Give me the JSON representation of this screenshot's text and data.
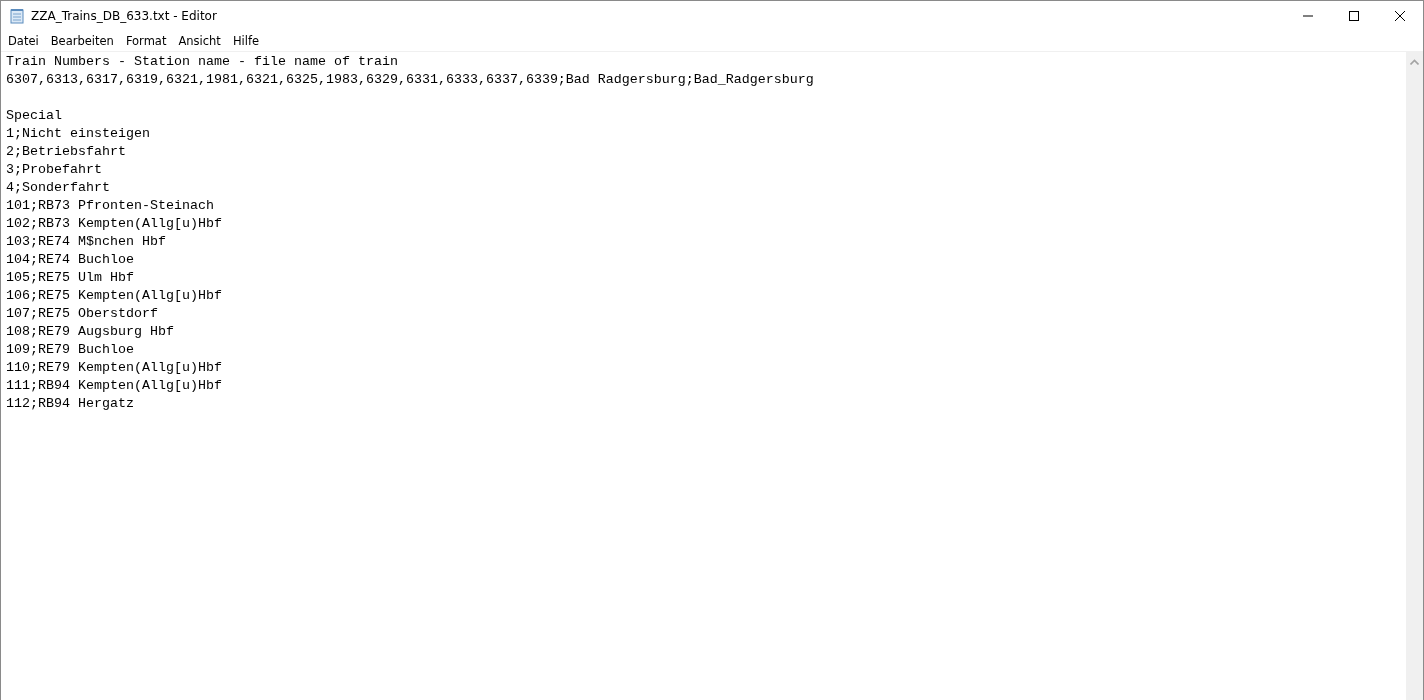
{
  "window": {
    "title": "ZZA_Trains_DB_633.txt - Editor"
  },
  "menu": [
    "Datei",
    "Bearbeiten",
    "Format",
    "Ansicht",
    "Hilfe"
  ],
  "editor": {
    "blocks": [
      [
        "Train Numbers - Station name - file name of train",
        "6307,6313,6317,6319,6321,1981,6321,6325,1983,6329,6331,6333,6337,6339;Bad Radgersburg;Bad_Radgersburg"
      ],
      [
        "Special",
        "1;Nicht einsteigen",
        "2;Betriebsfahrt",
        "3;Probefahrt",
        "4;Sonderfahrt",
        "101;RB73 Pfronten-Steinach",
        "102;RB73 Kempten(Allg[u)Hbf",
        "103;RE74 M$nchen Hbf",
        "104;RE74 Buchloe",
        "105;RE75 Ulm Hbf",
        "106;RE75 Kempten(Allg[u)Hbf",
        "107;RE75 Oberstdorf",
        "108;RE79 Augsburg Hbf",
        "109;RE79 Buchloe",
        "110;RE79 Kempten(Allg[u)Hbf",
        "111;RB94 Kempten(Allg[u)Hbf",
        "112;RB94 Hergatz"
      ]
    ]
  }
}
